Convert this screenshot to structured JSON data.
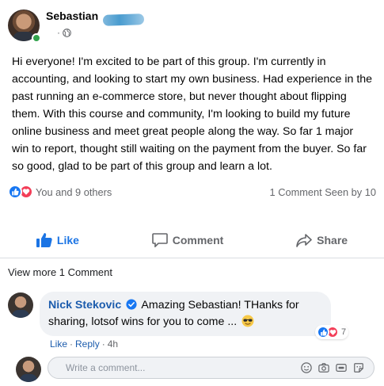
{
  "post": {
    "author": "Sebastian Molina",
    "author_visible": "Sebastian ",
    "meta_dot": "·",
    "privacy_icon": "globe-icon",
    "body": "Hi everyone! I'm excited to be part of this group. I'm currently in accounting, and looking to start my own business. Had experience in the past running an e-commerce store, but never thought about flipping them. With this course and community, I'm looking to build my future online business and meet great people along the way. So far 1 major win to report, thought still waiting on the payment from the buyer. So far so good, glad to be part of this group and learn a lot."
  },
  "reactions": {
    "icons": [
      "like-reaction-icon",
      "love-reaction-icon"
    ],
    "summary": "You and 9 others",
    "stats": "1 Comment Seen by 10"
  },
  "actions": {
    "like": "Like",
    "comment": "Comment",
    "share": "Share"
  },
  "view_more": "View more 1 Comment",
  "comment": {
    "author": "Nick Stekovic",
    "text": "Amazing Sebastian! THanks for sharing, lotsof wins for you to come ...",
    "emoji_icon": "sunglasses-emoji-icon",
    "reaction_count": "7",
    "like_link": "Like",
    "reply_link": "Reply",
    "separator": "·",
    "time": "4h"
  },
  "composer": {
    "placeholder": "Write a comment..."
  },
  "colors": {
    "brand_blue": "#1877f2",
    "link_blue": "#1c5cad",
    "love_red": "#f33e58",
    "online_green": "#31a24c",
    "muted_text": "#65676b",
    "bubble_bg": "#f0f2f5"
  }
}
